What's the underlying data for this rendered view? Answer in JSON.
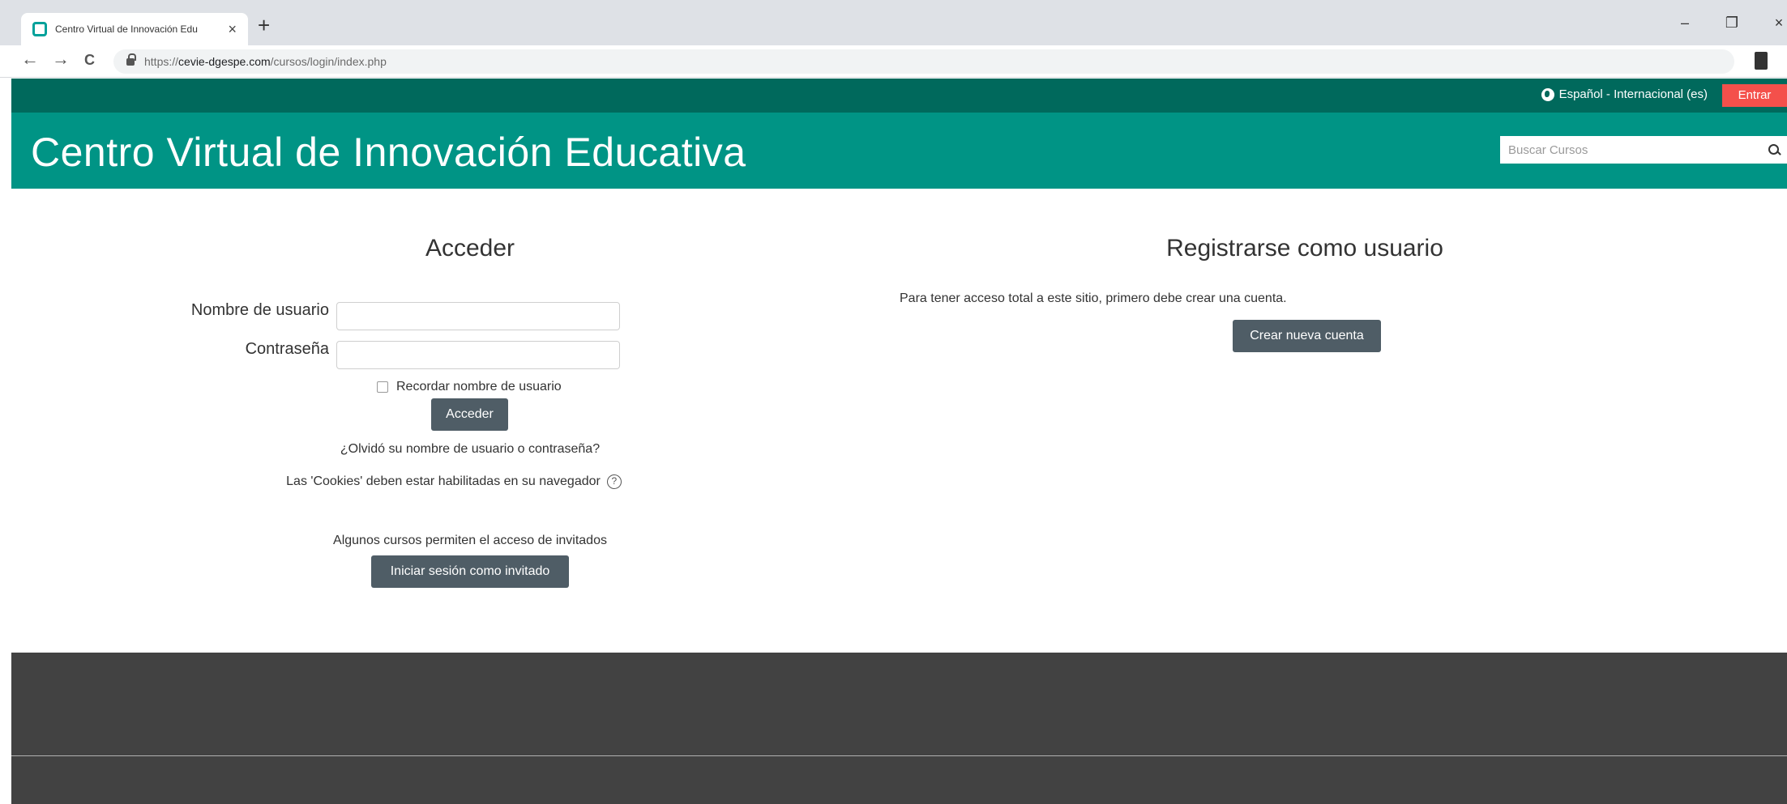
{
  "browser": {
    "tab_title": "Centro Virtual de Innovación Edu",
    "tab_close": "×",
    "new_tab": "+",
    "url_scheme": "https://",
    "url_host": "cevie-dgespe.com",
    "url_path": "/cursos/login/index.php",
    "back": "←",
    "forward": "→",
    "reload": "C",
    "minimize": "–",
    "restore": "❐",
    "close": "×"
  },
  "site": {
    "language": "Español - Internacional (es)",
    "login_link": "Entrar",
    "title": "Centro Virtual de Innovación Educativa",
    "search_placeholder": "Buscar Cursos"
  },
  "login": {
    "heading": "Acceder",
    "username_label": "Nombre de usuario",
    "password_label": "Contraseña",
    "remember": "Recordar nombre de usuario",
    "submit": "Acceder",
    "forgot": "¿Olvidó su nombre de usuario o contraseña?",
    "cookies": "Las 'Cookies' deben estar habilitadas en su navegador",
    "cookies_help": "?",
    "guest_note": "Algunos cursos permiten el acceso de invitados",
    "guest_button": "Iniciar sesión como invitado"
  },
  "register": {
    "heading": "Registrarse como usuario",
    "text": "Para tener acceso total a este sitio, primero debe crear una cuenta.",
    "button": "Crear nueva cuenta"
  },
  "colors": {
    "topbar": "#00695c",
    "brandbar": "#009485",
    "login_button": "#f4504b",
    "action_button": "#4f5d66",
    "footer": "#424242"
  }
}
